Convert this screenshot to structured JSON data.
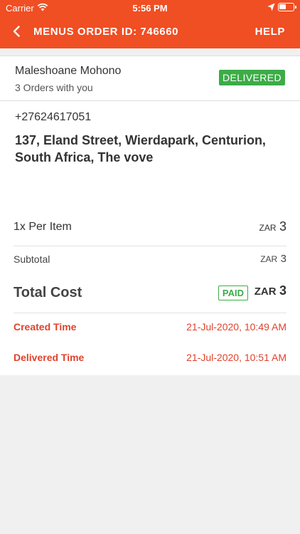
{
  "status_bar": {
    "carrier": "Carrier",
    "time": "5:56 PM"
  },
  "nav": {
    "title": "MENUS ORDER ID: 746660",
    "help_label": "HELP",
    "bar_color": "#f04e23"
  },
  "customer": {
    "name": "Maleshoane Mohono",
    "orders_text": "3 Orders with you",
    "status_badge": "DELIVERED",
    "phone": "+27624617051",
    "address": "137, Eland Street, Wierdapark, Centurion, South Africa, The vove"
  },
  "order": {
    "items": [
      {
        "label": "1x Per Item",
        "currency": "ZAR",
        "amount": "3"
      }
    ],
    "subtotal": {
      "label": "Subtotal",
      "currency": "ZAR",
      "amount": "3"
    },
    "total": {
      "label": "Total Cost",
      "payment_badge": "PAID",
      "currency": "ZAR",
      "amount": "3"
    },
    "created": {
      "label": "Created Time",
      "value": "21-Jul-2020, 10:49 AM"
    },
    "delivered": {
      "label": "Delivered Time",
      "value": "21-Jul-2020, 10:51 AM"
    }
  },
  "colors": {
    "accent": "#f04e23",
    "success": "#3cac47",
    "time_text": "#e0422c"
  }
}
